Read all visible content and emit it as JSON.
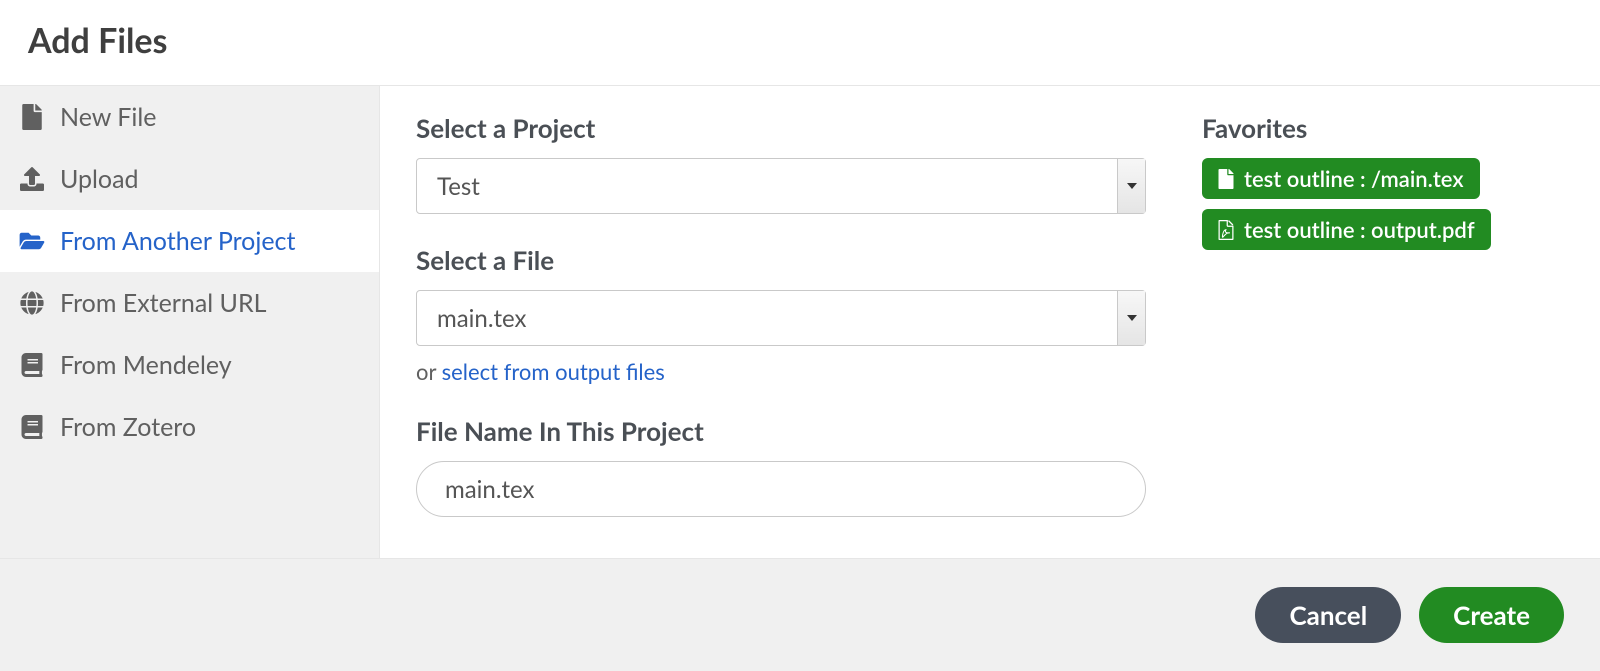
{
  "header": {
    "title": "Add Files"
  },
  "sidebar": {
    "items": [
      {
        "id": "new-file",
        "label": "New File",
        "icon": "file-icon"
      },
      {
        "id": "upload",
        "label": "Upload",
        "icon": "upload-icon"
      },
      {
        "id": "from-another-project",
        "label": "From Another Project",
        "icon": "folder-open-icon",
        "active": true
      },
      {
        "id": "from-external-url",
        "label": "From External URL",
        "icon": "globe-icon"
      },
      {
        "id": "from-mendeley",
        "label": "From Mendeley",
        "icon": "book-icon"
      },
      {
        "id": "from-zotero",
        "label": "From Zotero",
        "icon": "book-icon"
      }
    ]
  },
  "form": {
    "select_project_label": "Select a Project",
    "project_value": "Test",
    "select_file_label": "Select a File",
    "file_value": "main.tex",
    "or_text": "or ",
    "output_link": "select from output files",
    "filename_label": "File Name In This Project",
    "filename_value": "main.tex"
  },
  "favorites": {
    "title": "Favorites",
    "items": [
      {
        "label": "test outline : /main.tex",
        "icon": "file-icon"
      },
      {
        "label": "test outline : output.pdf",
        "icon": "pdf-icon"
      }
    ]
  },
  "footer": {
    "cancel": "Cancel",
    "create": "Create"
  }
}
